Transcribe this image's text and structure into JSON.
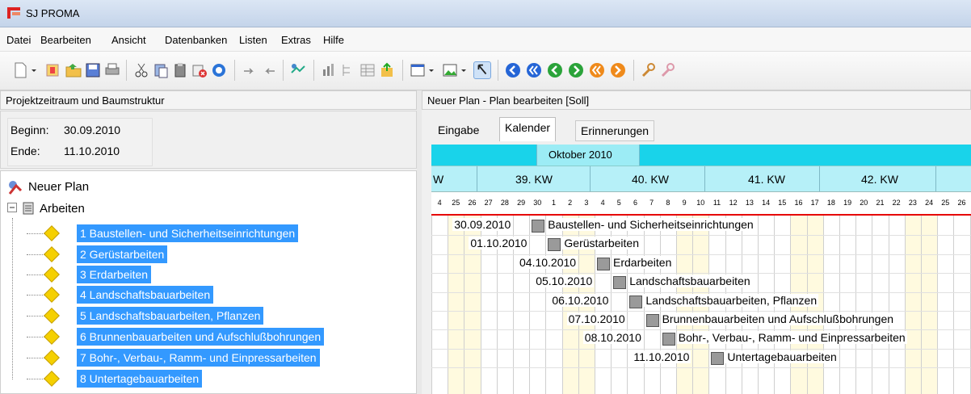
{
  "window": {
    "title": "SJ PROMA"
  },
  "menu": [
    "Datei",
    "Bearbeiten",
    "Ansicht",
    "Datenbanken",
    "Listen",
    "Extras",
    "Hilfe"
  ],
  "toolbar_icons": [
    "new-doc-icon",
    "dropdown-icon",
    "copy-icon",
    "open-folder-icon",
    "save-icon",
    "print-icon",
    "cut-icon",
    "paste-icon",
    "clipboard-icon",
    "delete-icon",
    "refresh-icon",
    "undo-icon",
    "redo-icon",
    "link-icon",
    "chart-icon",
    "tree-icon",
    "table-icon",
    "export-icon",
    "window-icon",
    "dropdown-icon",
    "image-icon",
    "dropdown-icon",
    "pointer-icon",
    "nav-first-icon",
    "nav-prev-icon",
    "nav-play-icon",
    "nav-next-icon",
    "nav-last-icon",
    "nav-stop-icon",
    "zoom-in-icon",
    "zoom-out-icon"
  ],
  "left_pane": {
    "header": "Projektzeitraum und Baumstruktur",
    "begin_label": "Beginn:",
    "begin_value": "30.09.2010",
    "end_label": "Ende:",
    "end_value": "11.10.2010",
    "tree": {
      "root": "Neuer Plan",
      "folder": "Arbeiten",
      "items": [
        "1 Baustellen- und Sicherheitseinrichtungen",
        "2 Gerüstarbeiten",
        "3 Erdarbeiten",
        "4 Landschaftsbauarbeiten",
        "5 Landschaftsbauarbeiten, Pflanzen",
        "6 Brunnenbauarbeiten und Aufschlußbohrungen",
        "7 Bohr-, Verbau-, Ramm- und Einpressarbeiten",
        "8 Untertagebauarbeiten"
      ]
    }
  },
  "right_pane": {
    "header": "Neuer Plan - Plan bearbeiten [Soll]",
    "tabs": [
      "Eingabe",
      "Kalender",
      "Erinnerungen"
    ],
    "active_tab": "Kalender",
    "calendar": {
      "month": "Oktober 2010",
      "weeks": [
        "W",
        "39. KW",
        "40. KW",
        "41. KW",
        "42. KW"
      ],
      "days": [
        "4",
        "25",
        "26",
        "27",
        "28",
        "29",
        "30",
        "1",
        "2",
        "3",
        "4",
        "5",
        "6",
        "7",
        "8",
        "9",
        "10",
        "11",
        "12",
        "13",
        "14",
        "15",
        "16",
        "17",
        "18",
        "19",
        "20",
        "21",
        "22",
        "23",
        "24",
        "25",
        "26"
      ],
      "tasks": [
        {
          "start": "30.09.2010",
          "name": "Baustellen- und Sicherheitseinrichtungen"
        },
        {
          "start": "01.10.2010",
          "name": "Gerüstarbeiten"
        },
        {
          "start": "04.10.2010",
          "name": "Erdarbeiten"
        },
        {
          "start": "05.10.2010",
          "name": "Landschaftsbauarbeiten"
        },
        {
          "start": "06.10.2010",
          "name": "Landschaftsbauarbeiten, Pflanzen"
        },
        {
          "start": "07.10.2010",
          "name": "Brunnenbauarbeiten und Aufschlußbohrungen"
        },
        {
          "start": "08.10.2010",
          "name": "Bohr-, Verbau-, Ramm- und Einpressarbeiten"
        },
        {
          "start": "11.10.2010",
          "name": "Untertagebauarbeiten"
        }
      ]
    }
  },
  "colors": {
    "selection": "#3399ff",
    "month_band": "#19d3ea",
    "week_band": "#b6f0f8",
    "today_line": "#e60000",
    "weekend": "#fffadf"
  }
}
